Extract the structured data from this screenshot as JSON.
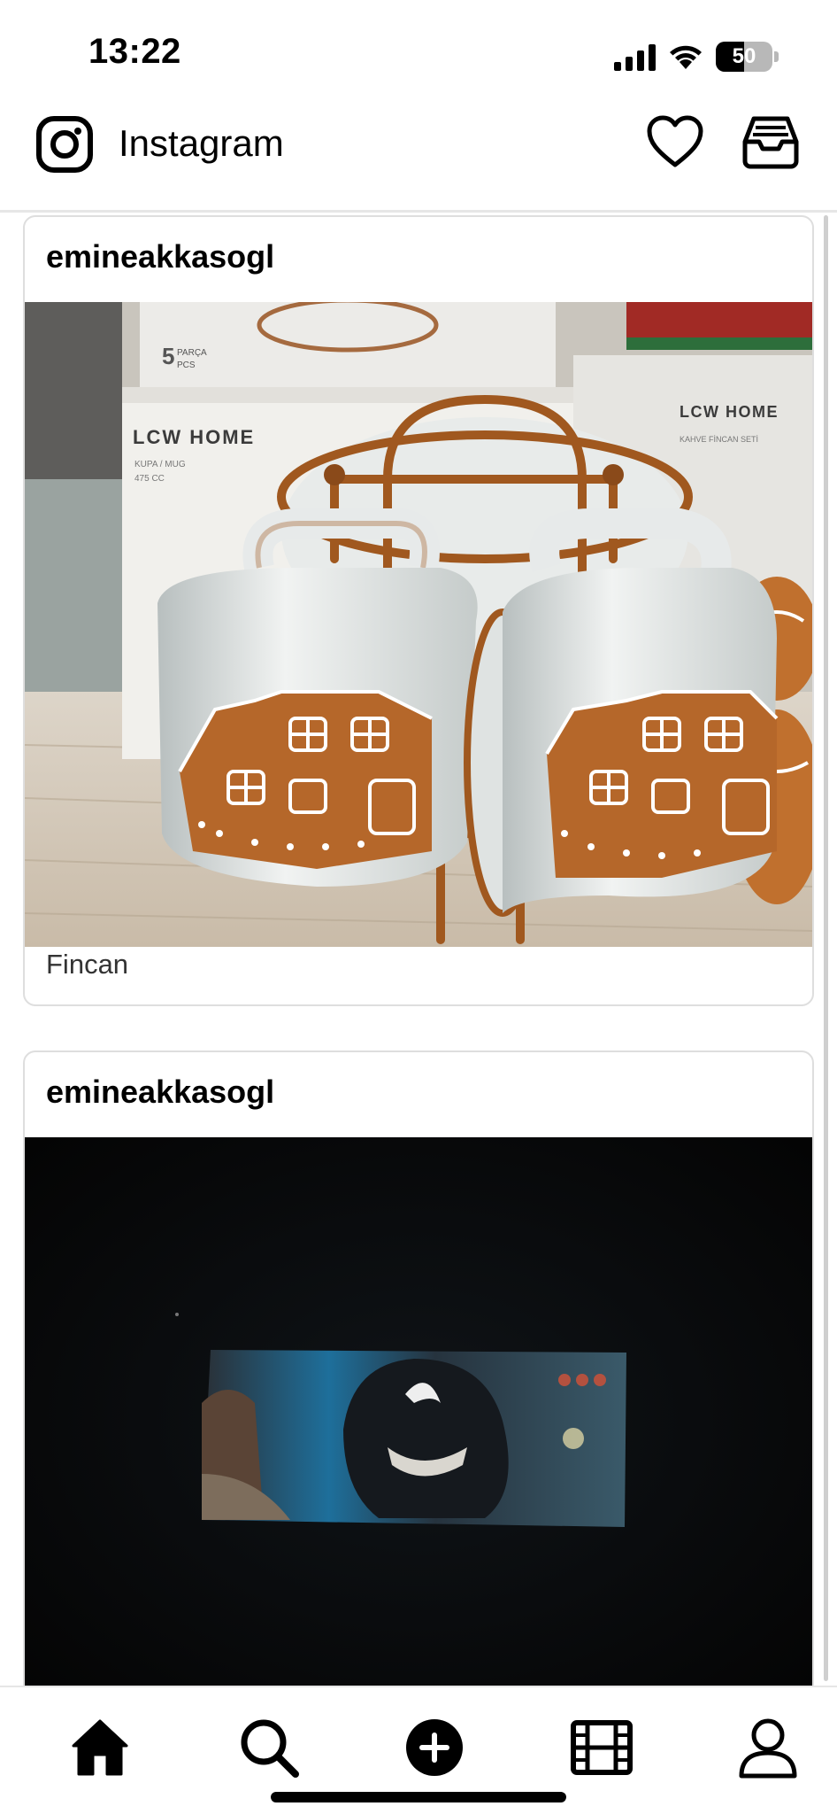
{
  "status_bar": {
    "time": "13:22",
    "battery_level": "50",
    "battery_fraction": 0.5,
    "signal_icon": "cellular-signal-icon",
    "wifi_icon": "wifi-icon"
  },
  "header": {
    "title": "Instagram",
    "logo_icon": "instagram-logo-icon",
    "actions": [
      {
        "icon": "heart-icon"
      },
      {
        "icon": "inbox-tray-icon"
      }
    ]
  },
  "posts": [
    {
      "username": "emineakkasogl",
      "caption": "Fincan",
      "image": {
        "box_labels": [
          "5",
          "PARÇA",
          "PCS",
          "LCW HOME",
          "KUPA / MUG",
          "475 CC",
          "LCW HOME",
          "KAHVE FİNCAN SETİ"
        ]
      }
    },
    {
      "username": "emineakkasogl",
      "caption": "",
      "image": {}
    }
  ],
  "bottom_nav": {
    "items": [
      {
        "icon": "home-icon",
        "active": true
      },
      {
        "icon": "search-icon",
        "active": false
      },
      {
        "icon": "create-plus-icon",
        "active": false
      },
      {
        "icon": "reels-icon",
        "active": false
      },
      {
        "icon": "profile-icon",
        "active": false
      }
    ]
  },
  "colors": {
    "text": "#000000",
    "border": "#dedede",
    "mug_brown": "#a0581f",
    "mug_white": "#e9ecec"
  }
}
